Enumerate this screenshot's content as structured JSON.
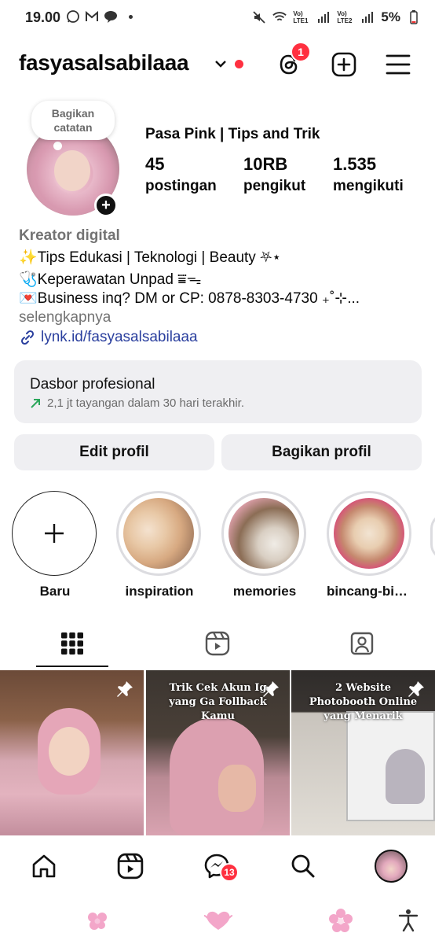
{
  "status_bar": {
    "time": "19.00",
    "battery": "5%",
    "sim1": "Vo) LTE1",
    "sim2": "Vo) LTE2"
  },
  "header": {
    "username": "fasyasalsabilaaa",
    "threads_badge": "1"
  },
  "profile": {
    "note_text": "Bagikan catatan",
    "display_name": "Pasa Pink | Tips and Trik",
    "stats": [
      {
        "num": "45",
        "label": "postingan"
      },
      {
        "num": "10RB",
        "label": "pengikut"
      },
      {
        "num": "1.535",
        "label": "mengikuti"
      }
    ],
    "category": "Kreator digital",
    "bio": [
      "✨Tips Edukasi | Teknologi | Beauty ⛧⋆",
      "🩺Keperawatan Unpad ⩸ᯓ",
      "💌Business inq? DM or CP: 0878-8303-4730 ₊˚⊹..."
    ],
    "more": "selengkapnya",
    "link": "lynk.id/fasyasalsabilaaa"
  },
  "dashboard": {
    "title": "Dasbor profesional",
    "subtitle": "2,1 jt tayangan dalam 30 hari terakhir."
  },
  "buttons": {
    "edit": "Edit profil",
    "share": "Bagikan profil"
  },
  "highlights": [
    {
      "label": "Baru"
    },
    {
      "label": "inspiration"
    },
    {
      "label": "memories"
    },
    {
      "label": "bincang-binc..."
    }
  ],
  "posts": [
    {
      "caption": ""
    },
    {
      "caption": "Trik Cek Akun Ig yang Ga Follback Kamu"
    },
    {
      "caption": "2 Website Photobooth Online yang Menarik"
    }
  ],
  "bottom_nav": {
    "messages_badge": "13"
  },
  "colors": {
    "accent_red": "#ff3040",
    "link_blue": "#2a3f9e",
    "muted_grey": "#737373",
    "panel_grey": "#efeff2"
  }
}
